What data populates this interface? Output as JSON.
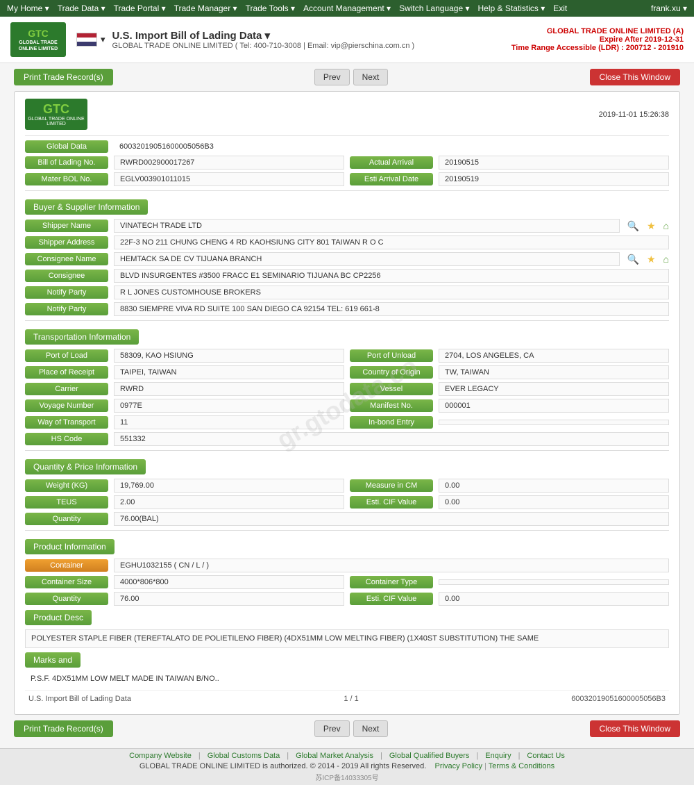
{
  "topnav": {
    "items": [
      {
        "label": "My Home ▾",
        "id": "my-home"
      },
      {
        "label": "Trade Data ▾",
        "id": "trade-data"
      },
      {
        "label": "Trade Portal ▾",
        "id": "trade-portal"
      },
      {
        "label": "Trade Manager ▾",
        "id": "trade-manager"
      },
      {
        "label": "Trade Tools ▾",
        "id": "trade-tools"
      },
      {
        "label": "Account Management ▾",
        "id": "account-management"
      },
      {
        "label": "Switch Language ▾",
        "id": "switch-language"
      },
      {
        "label": "Help & Statistics ▾",
        "id": "help-statistics"
      },
      {
        "label": "Exit",
        "id": "exit"
      }
    ],
    "user": "frank.xu ▾"
  },
  "header": {
    "title": "U.S. Import Bill of Lading Data ▾",
    "contact": "GLOBAL TRADE ONLINE LIMITED ( Tel: 400-710-3008 | Email: vip@pierschina.com.cn )",
    "brand": "GLOBAL TRADE ONLINE LIMITED (A)",
    "expire": "Expire After 2019-12-31",
    "time_range": "Time Range Accessible (LDR) : 200712 - 201910"
  },
  "toolbar": {
    "print_label": "Print Trade Record(s)",
    "prev_label": "Prev",
    "next_label": "Next",
    "close_label": "Close This Window"
  },
  "record": {
    "datetime": "2019-11-01 15:26:38",
    "logo_sub": "GLOBAL TRADE ONLINE LIMITED",
    "global_data_label": "Global Data",
    "global_data_value": "60032019051600005056B3",
    "bol_label": "Bill of Lading No.",
    "bol_value": "RWRD002900017267",
    "actual_arrival_label": "Actual Arrival",
    "actual_arrival_value": "20190515",
    "master_bol_label": "Mater BOL No.",
    "master_bol_value": "EGLV003901011015",
    "esti_arrival_label": "Esti Arrival Date",
    "esti_arrival_value": "20190519",
    "buyer_supplier_section": "Buyer & Supplier Information",
    "shipper_name_label": "Shipper Name",
    "shipper_name_value": "VINATECH TRADE LTD",
    "shipper_address_label": "Shipper Address",
    "shipper_address_value": "22F-3 NO 211 CHUNG CHENG 4 RD KAOHSIUNG CITY 801 TAIWAN R O C",
    "consignee_name_label": "Consignee Name",
    "consignee_name_value": "HEMTACK SA DE CV TIJUANA BRANCH",
    "consignee_label": "Consignee",
    "consignee_value": "BLVD INSURGENTES #3500 FRACC E1 SEMINARIO TIJUANA BC CP2256",
    "notify_party_label": "Notify Party",
    "notify_party_value1": "R L JONES CUSTOMHOUSE BROKERS",
    "notify_party_value2": "8830 SIEMPRE VIVA RD SUITE 100 SAN DIEGO CA 92154 TEL: 619 661-8",
    "transport_section": "Transportation Information",
    "port_of_load_label": "Port of Load",
    "port_of_load_value": "58309, KAO HSIUNG",
    "port_of_unload_label": "Port of Unload",
    "port_of_unload_value": "2704, LOS ANGELES, CA",
    "place_of_receipt_label": "Place of Receipt",
    "place_of_receipt_value": "TAIPEI, TAIWAN",
    "country_of_origin_label": "Country of Origin",
    "country_of_origin_value": "TW, TAIWAN",
    "carrier_label": "Carrier",
    "carrier_value": "RWRD",
    "vessel_label": "Vessel",
    "vessel_value": "EVER LEGACY",
    "voyage_label": "Voyage Number",
    "voyage_value": "0977E",
    "manifest_label": "Manifest No.",
    "manifest_value": "000001",
    "way_of_transport_label": "Way of Transport",
    "way_of_transport_value": "11",
    "in_bond_entry_label": "In-bond Entry",
    "in_bond_entry_value": "",
    "hs_code_label": "HS Code",
    "hs_code_value": "551332",
    "quantity_price_section": "Quantity & Price Information",
    "weight_kg_label": "Weight (KG)",
    "weight_kg_value": "19,769.00",
    "measure_in_cm_label": "Measure in CM",
    "measure_in_cm_value": "0.00",
    "teus_label": "TEUS",
    "teus_value": "2.00",
    "esti_cif_value_label": "Esti. CIF Value",
    "esti_cif_value1": "0.00",
    "quantity_label": "Quantity",
    "quantity_value": "76.00(BAL)",
    "product_section": "Product Information",
    "container_label": "Container",
    "container_value": "EGHU1032155 ( CN / L / )",
    "container_size_label": "Container Size",
    "container_size_value": "4000*806*800",
    "container_type_label": "Container Type",
    "container_type_value": "",
    "product_quantity_label": "Quantity",
    "product_quantity_value": "76.00",
    "esti_cif_label2": "Esti. CIF Value",
    "esti_cif_value2": "0.00",
    "product_desc_label": "Product Desc",
    "product_desc_value": "POLYESTER STAPLE FIBER (TEREFTALATO DE POLIETILENO FIBER) (4DX51MM LOW MELTING FIBER) (1X40ST SUBSTITUTION) THE SAME",
    "marks_label": "Marks and",
    "marks_value": "P.S.F. 4DX51MM LOW MELT MADE IN TAIWAN B/NO..",
    "footer_left": "U.S. Import Bill of Lading Data",
    "footer_page": "1 / 1",
    "footer_id": "60032019051600005056B3"
  },
  "page_footer": {
    "links": [
      "Company Website",
      "Global Customs Data",
      "Global Market Analysis",
      "Global Qualified Buyers",
      "Enquiry",
      "Contact Us"
    ],
    "copyright": "GLOBAL TRADE ONLINE LIMITED is authorized. © 2014 - 2019 All rights Reserved.",
    "policy_links": [
      "Privacy Policy",
      "Terms & Conditions"
    ],
    "icp": "苏ICP备14033305号"
  }
}
